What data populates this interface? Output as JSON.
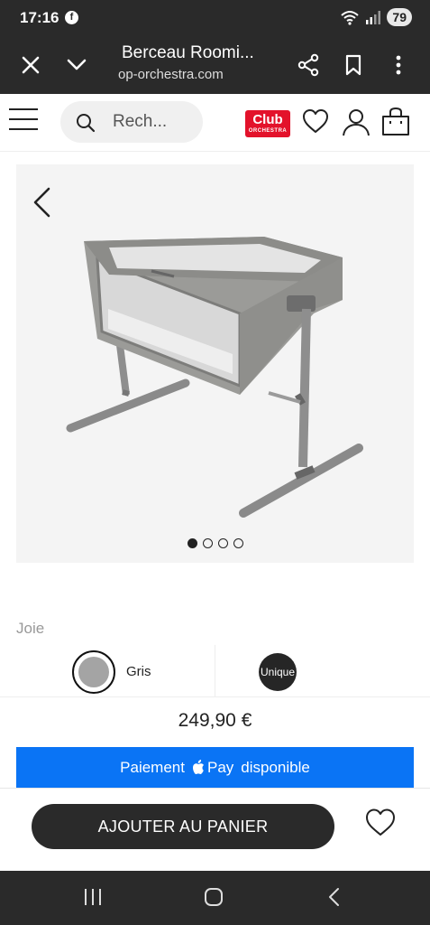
{
  "status_bar": {
    "time": "17:16",
    "battery": "79",
    "fb_glyph": "f"
  },
  "browser": {
    "title": "Berceau Roomi...",
    "url": "op-orchestra.com",
    "icons": [
      "close-icon",
      "chevron-down-icon",
      "share-icon",
      "bookmark-icon",
      "more-vert-icon"
    ]
  },
  "header": {
    "search_placeholder": "Rech...",
    "club_logo_line1": "Club",
    "club_logo_line2": "ORCHESTRA",
    "icons": [
      "menu-icon",
      "search-icon",
      "heart-icon",
      "user-icon",
      "bag-icon"
    ]
  },
  "gallery": {
    "slide_count": 4,
    "active_slide": 1,
    "product_image": "gray-bedside-crib-on-metal-legs"
  },
  "product": {
    "brand": "Joie",
    "color_label": "Gris",
    "color_swatch": "#a4a4a4",
    "size_label": "Unique",
    "price": "249,90 €",
    "applepay_prefix": "Paiement",
    "applepay_pay": "Pay",
    "applepay_suffix": "disponible",
    "applepay_color": "#0a74f5",
    "add_to_cart": "AJOUTER AU PANIER"
  },
  "nav": {
    "icons": [
      "recent-apps-icon",
      "home-icon",
      "back-icon"
    ]
  }
}
